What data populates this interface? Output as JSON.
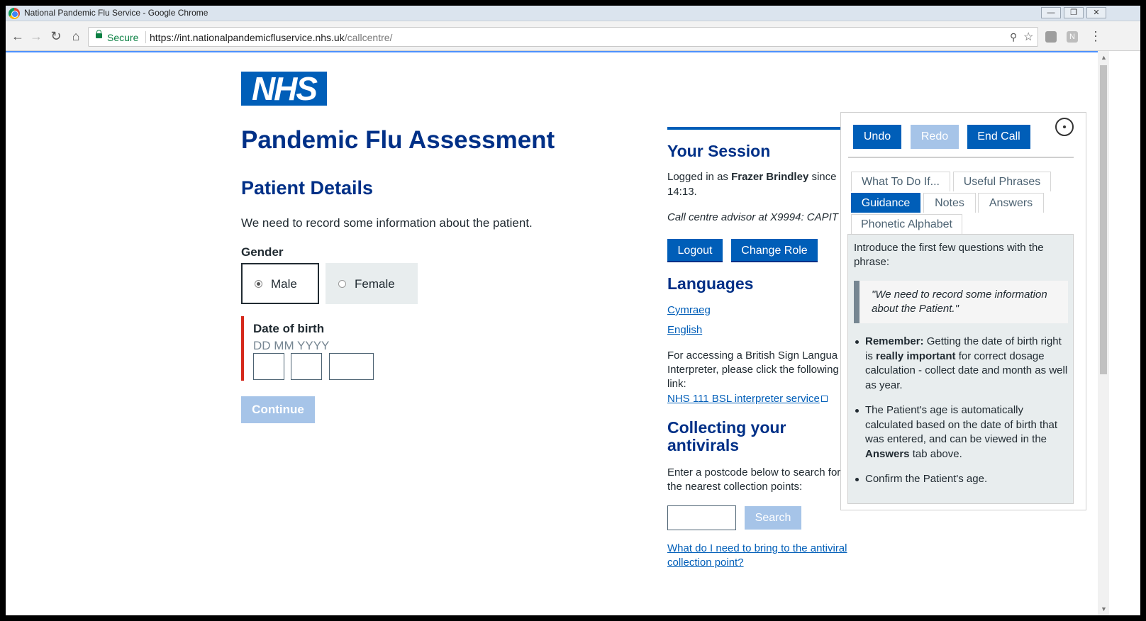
{
  "browser": {
    "window_title": "National Pandemic Flu Service - Google Chrome",
    "secure_label": "Secure",
    "url_base": "https://int.nationalpandemicfluservice.nhs.uk",
    "url_path": "/callcentre/",
    "extension_letter": "N"
  },
  "page": {
    "logo": "NHS",
    "title": "Pandemic Flu Assessment",
    "section_title": "Patient Details",
    "lead": "We need to record some information about the patient.",
    "gender_label": "Gender",
    "gender_options": [
      "Male",
      "Female"
    ],
    "gender_selected": "Male",
    "dob_label": "Date of birth",
    "dob_hint": "DD MM YYYY",
    "continue_label": "Continue"
  },
  "session": {
    "heading": "Your Session",
    "logged_prefix": "Logged in as ",
    "user": "Frazer Brindley",
    "logged_suffix": " since",
    "time": "14:13.",
    "role": "Call centre advisor at X9994: CAPIT",
    "logout_label": "Logout",
    "change_role_label": "Change Role"
  },
  "languages": {
    "heading": "Languages",
    "links": [
      "Cymraeg",
      "English"
    ],
    "bsl_text_lines": [
      "For accessing a British Sign Langua",
      "Interpreter, please click the following",
      "link:"
    ],
    "bsl_link": "NHS 111 BSL interpreter service"
  },
  "antivirals": {
    "heading": "Collecting your antivirals",
    "text_lines": [
      "Enter a postcode below to search for",
      "the nearest collection points:"
    ],
    "search_label": "Search",
    "bring_link_lines": [
      "What do I need to bring to the antiviral",
      "collection point?"
    ]
  },
  "panel": {
    "undo_label": "Undo",
    "redo_label": "Redo",
    "end_call_label": "End Call",
    "tabs": {
      "what_to_do": "What To Do If...",
      "useful_phrases": "Useful Phrases",
      "guidance": "Guidance",
      "notes": "Notes",
      "answers": "Answers",
      "phonetic": "Phonetic Alphabet"
    },
    "active_tab": "Guidance",
    "guidance": {
      "intro": "Introduce the first few questions with the phrase:",
      "quote": "\"We need to record some information about the Patient.\"",
      "item1_bold": "Remember:",
      "item1_a": " Getting the date of birth right is ",
      "item1_bold2": "really important",
      "item1_b": " for correct dosage calculation - collect date and month as well as year.",
      "item2_a": "The Patient's age is automatically calculated based on the date of birth that was entered, and can be viewed in the ",
      "item2_bold": "Answers",
      "item2_b": " tab above.",
      "item3": "Confirm the Patient's age."
    }
  },
  "colors": {
    "nhs_blue": "#005eb8",
    "nhs_dark_blue": "#003087",
    "disabled_blue": "#a6c4e8",
    "error_red": "#d5281b"
  }
}
